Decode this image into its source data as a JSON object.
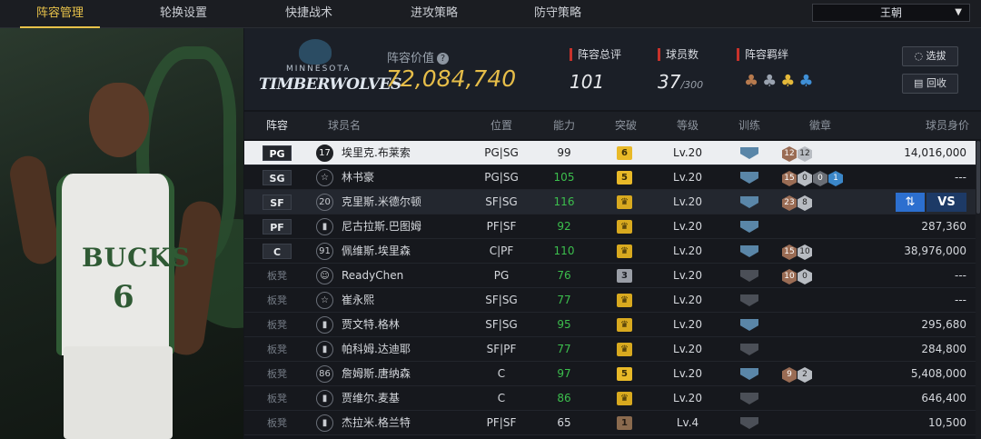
{
  "tabs": [
    {
      "label": "阵容管理",
      "active": true
    },
    {
      "label": "轮换设置",
      "active": false
    },
    {
      "label": "快捷战术",
      "active": false
    },
    {
      "label": "进攻策略",
      "active": false
    },
    {
      "label": "防守策略",
      "active": false
    }
  ],
  "team_select": {
    "value": "王朝"
  },
  "hero_player": {
    "jersey_text": "BUCKS",
    "jersey_number": "6"
  },
  "team_logo": {
    "line1": "MINNESOTA",
    "line2": "TIMBERWOLVES"
  },
  "lineup_value": {
    "label": "阵容价值",
    "value": "72,084,740"
  },
  "stats": {
    "rating": {
      "label": "阵容总评",
      "value": "101"
    },
    "players": {
      "label": "球员数",
      "value": "37",
      "max": "/300"
    },
    "bonds": {
      "label": "阵容羁绊"
    }
  },
  "buttons": {
    "select": "选拔",
    "recycle": "回收"
  },
  "columns": {
    "lineup": "阵容",
    "name": "球员名",
    "position": "位置",
    "ability": "能力",
    "breakthrough": "突破",
    "level": "等级",
    "training": "训练",
    "badges": "徽章",
    "worth": "球员身价"
  },
  "rows": [
    {
      "slot": "PG",
      "num": "17",
      "name": "埃里克.布莱索",
      "pos": "PG|SG",
      "power": "99",
      "brk": "6",
      "level": "Lv.20",
      "worth": "14,016,000"
    },
    {
      "slot": "SG",
      "num": "☆",
      "name": "林书豪",
      "pos": "PG|SG",
      "power": "105",
      "brk": "5",
      "level": "Lv.20",
      "worth": "---"
    },
    {
      "slot": "SF",
      "num": "20",
      "name": "克里斯.米德尔顿",
      "pos": "SF|SG",
      "power": "116",
      "brk": "♛",
      "level": "Lv.20",
      "worth": ""
    },
    {
      "slot": "PF",
      "num": "▮",
      "name": "尼古拉斯.巴图姆",
      "pos": "PF|SF",
      "power": "92",
      "brk": "♛",
      "level": "Lv.20",
      "worth": "287,360"
    },
    {
      "slot": "C",
      "num": "91",
      "name": "佩维斯.埃里森",
      "pos": "C|PF",
      "power": "110",
      "brk": "♛",
      "level": "Lv.20",
      "worth": "38,976,000"
    },
    {
      "slot": "板凳",
      "num": "☺",
      "name": "ReadyChen",
      "pos": "PG",
      "power": "76",
      "brk": "3",
      "level": "Lv.20",
      "worth": "---"
    },
    {
      "slot": "板凳",
      "num": "☆",
      "name": "崔永熙",
      "pos": "SF|SG",
      "power": "77",
      "brk": "♛",
      "level": "Lv.20",
      "worth": "---"
    },
    {
      "slot": "板凳",
      "num": "▮",
      "name": "贾文特.格林",
      "pos": "SF|SG",
      "power": "95",
      "brk": "♛",
      "level": "Lv.20",
      "worth": "295,680"
    },
    {
      "slot": "板凳",
      "num": "▮",
      "name": "帕科姆.达迪耶",
      "pos": "SF|PF",
      "power": "77",
      "brk": "♛",
      "level": "Lv.20",
      "worth": "284,800"
    },
    {
      "slot": "板凳",
      "num": "86",
      "name": "詹姆斯.唐纳森",
      "pos": "C",
      "power": "97",
      "brk": "5",
      "level": "Lv.20",
      "worth": "5,408,000"
    },
    {
      "slot": "板凳",
      "num": "▮",
      "name": "贾维尔.麦基",
      "pos": "C",
      "power": "86",
      "brk": "♛",
      "level": "Lv.20",
      "worth": "646,400"
    },
    {
      "slot": "板凳",
      "num": "▮",
      "name": "杰拉米.格兰特",
      "pos": "PF|SF",
      "power": "65",
      "brk": "1",
      "level": "Lv.4",
      "worth": "10,500"
    }
  ],
  "badges": {
    "r0": [
      "12",
      "12"
    ],
    "r1": [
      "15",
      "0",
      "0",
      "1"
    ],
    "r2": [
      "23",
      "8"
    ],
    "r4": [
      "15",
      "10"
    ],
    "r5": [
      "10",
      "0"
    ],
    "r9": [
      "9",
      "2"
    ]
  },
  "row_actions": {
    "swap": "⇅",
    "vs": "VS"
  }
}
